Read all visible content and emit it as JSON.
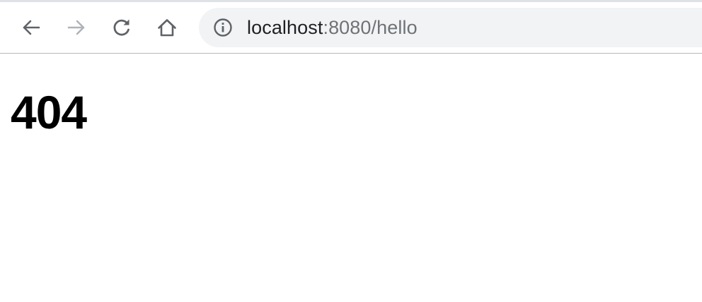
{
  "browser": {
    "address_bar": {
      "host": "localhost",
      "path": ":8080/hello"
    },
    "buttons": {
      "back": "back-arrow-icon",
      "forward": "forward-arrow-icon",
      "reload": "reload-icon",
      "home": "home-icon"
    },
    "colors": {
      "omnibox_bg": "#f1f3f4",
      "icon_active": "#5f6368",
      "icon_disabled": "#b0b3b8",
      "url_host": "#202124",
      "url_path": "#6f7276"
    }
  },
  "page": {
    "heading": "404"
  }
}
